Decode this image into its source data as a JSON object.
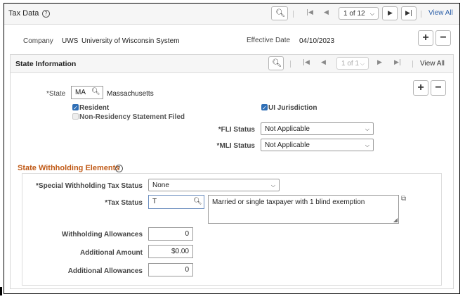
{
  "tax_data": {
    "title": "Tax Data",
    "pagination": "1 of 12",
    "view_all": "View All"
  },
  "company": {
    "label": "Company",
    "code": "UWS",
    "name": "University of Wisconsin System",
    "effective_date_label": "Effective Date",
    "effective_date": "04/10/2023"
  },
  "state_info": {
    "title": "State Information",
    "pagination": "1 of 1",
    "view_all": "View All",
    "state_label": "*State",
    "state_code": "MA",
    "state_name": "Massachusetts",
    "resident_label": "Resident",
    "ui_jurisdiction_label": "UI Jurisdiction",
    "non_residency_label": "Non-Residency Statement Filed",
    "fli_status_label": "*FLI Status",
    "fli_status_value": "Not Applicable",
    "mli_status_label": "*MLI Status",
    "mli_status_value": "Not Applicable"
  },
  "withholding": {
    "title": "State Withholding Elements",
    "special_label": "*Special Withholding Tax Status",
    "special_value": "None",
    "tax_status_label": "*Tax Status",
    "tax_status_value": "T",
    "tax_status_description": "Married or single taxpayer with 1 blind exemption",
    "allowances_label": "Withholding Allowances",
    "allowances_value": "0",
    "additional_amount_label": "Additional Amount",
    "additional_amount_value": "$0.00",
    "additional_allowances_label": "Additional Allowances",
    "additional_allowances_value": "0"
  },
  "icons": {
    "help": "help-circle-icon",
    "search": "magnifier-icon",
    "first": "first-page-icon",
    "prev": "previous-icon",
    "next": "next-icon",
    "last": "last-page-icon",
    "add": "plus-icon",
    "remove": "minus-icon",
    "expand": "expand-icon"
  },
  "colors": {
    "section_title": "#c05a17",
    "link": "#2b5fa8",
    "checkbox_checked": "#2f6fb6"
  }
}
